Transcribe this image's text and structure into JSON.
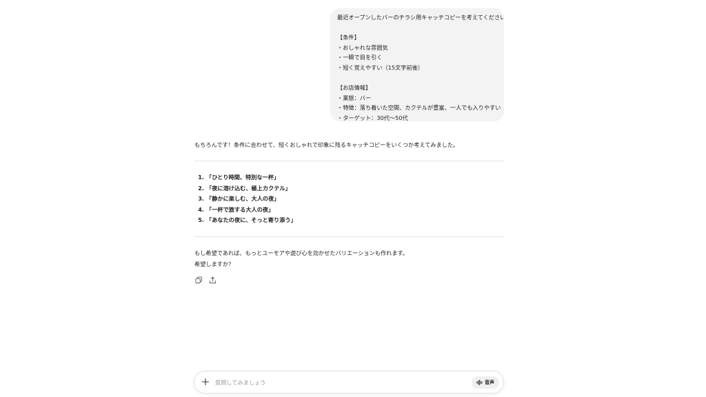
{
  "user_message": {
    "request": "最近オープンしたバーのチラシ用キャッチコピーを考えてください。",
    "conditions_header": "【条件】",
    "conditions": [
      "・おしゃれな雰囲気",
      "・一瞬で目を引く",
      "・短く覚えやすい（15文字前後）"
    ],
    "shop_info_header": "【お店情報】",
    "shop_info": [
      "・業態：バー",
      "・特徴：落ち着いた空間、カクテルが豊富、一人でも入りやすい",
      "・ターゲット：30代〜50代"
    ]
  },
  "assistant_message": {
    "intro": "もちろんです！条件に合わせて、短くおしゃれで印象に残るキャッチコピーをいくつか考えてみました。",
    "copies": [
      {
        "num": "1.",
        "text": "「ひとり時間、特別な一杯」"
      },
      {
        "num": "2.",
        "text": "「夜に溶け込む、極上カクテル」"
      },
      {
        "num": "3.",
        "text": "「静かに楽しむ、大人の夜」"
      },
      {
        "num": "4.",
        "text": "「一杯で旅する大人の夜」"
      },
      {
        "num": "5.",
        "text": "「あなたの夜に、そっと寄り添う」"
      }
    ],
    "closing_line1": "もし希望であれば、もっとユーモアや遊び心を効かせたバリエーションも作れます。",
    "closing_line2": "希望しますか？"
  },
  "composer": {
    "placeholder": "質問してみましょう",
    "voice_label": "音声"
  },
  "icons": {
    "copy": "copy-icon",
    "share": "share-icon",
    "plus": "plus-icon",
    "voice": "waveform-icon"
  }
}
